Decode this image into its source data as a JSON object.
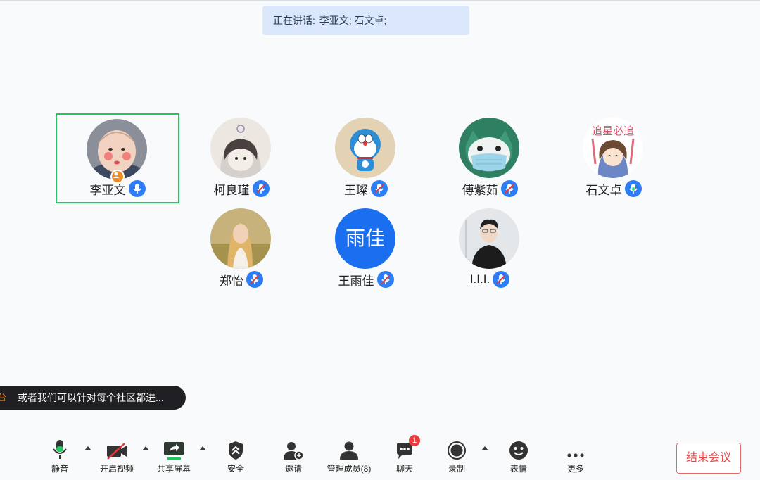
{
  "speaking_bar": {
    "label": "正在讲话:",
    "names": "李亚文; 石文卓;"
  },
  "participants": [
    {
      "name": "李亚文",
      "avatar": "baby-photo",
      "active": true,
      "host": true
    },
    {
      "name": "柯良瑾",
      "avatar": "cartoon-girl"
    },
    {
      "name": "王璨",
      "avatar": "doraemon"
    },
    {
      "name": "傅紫茹",
      "avatar": "masked-cat"
    },
    {
      "name": "石文卓",
      "avatar": "cartoon-girl-sign",
      "sign_text": "追星必追"
    },
    {
      "name": "郑怡",
      "avatar": "girl-photo"
    },
    {
      "name": "王雨佳",
      "avatar": "text-avatar",
      "avatar_text": "雨佳"
    },
    {
      "name": "I.I.I.",
      "avatar": "man-photo"
    }
  ],
  "chat_bubble": {
    "tag": "台",
    "message": "或者我们可以针对每个社区都进..."
  },
  "toolbar": {
    "mute": "静音",
    "video": "开启视频",
    "share": "共享屏幕",
    "security": "安全",
    "invite": "邀请",
    "members": "管理成员(8)",
    "chat": "聊天",
    "chat_unread": "1",
    "record": "录制",
    "emoji": "表情",
    "more": "更多"
  },
  "end_meeting": "结束会议",
  "colors": {
    "active_border": "#22c55e",
    "mic_badge": "#2d7df6",
    "end_button": "#e04a4a",
    "text_avatar_bg": "#1a6ff0"
  }
}
